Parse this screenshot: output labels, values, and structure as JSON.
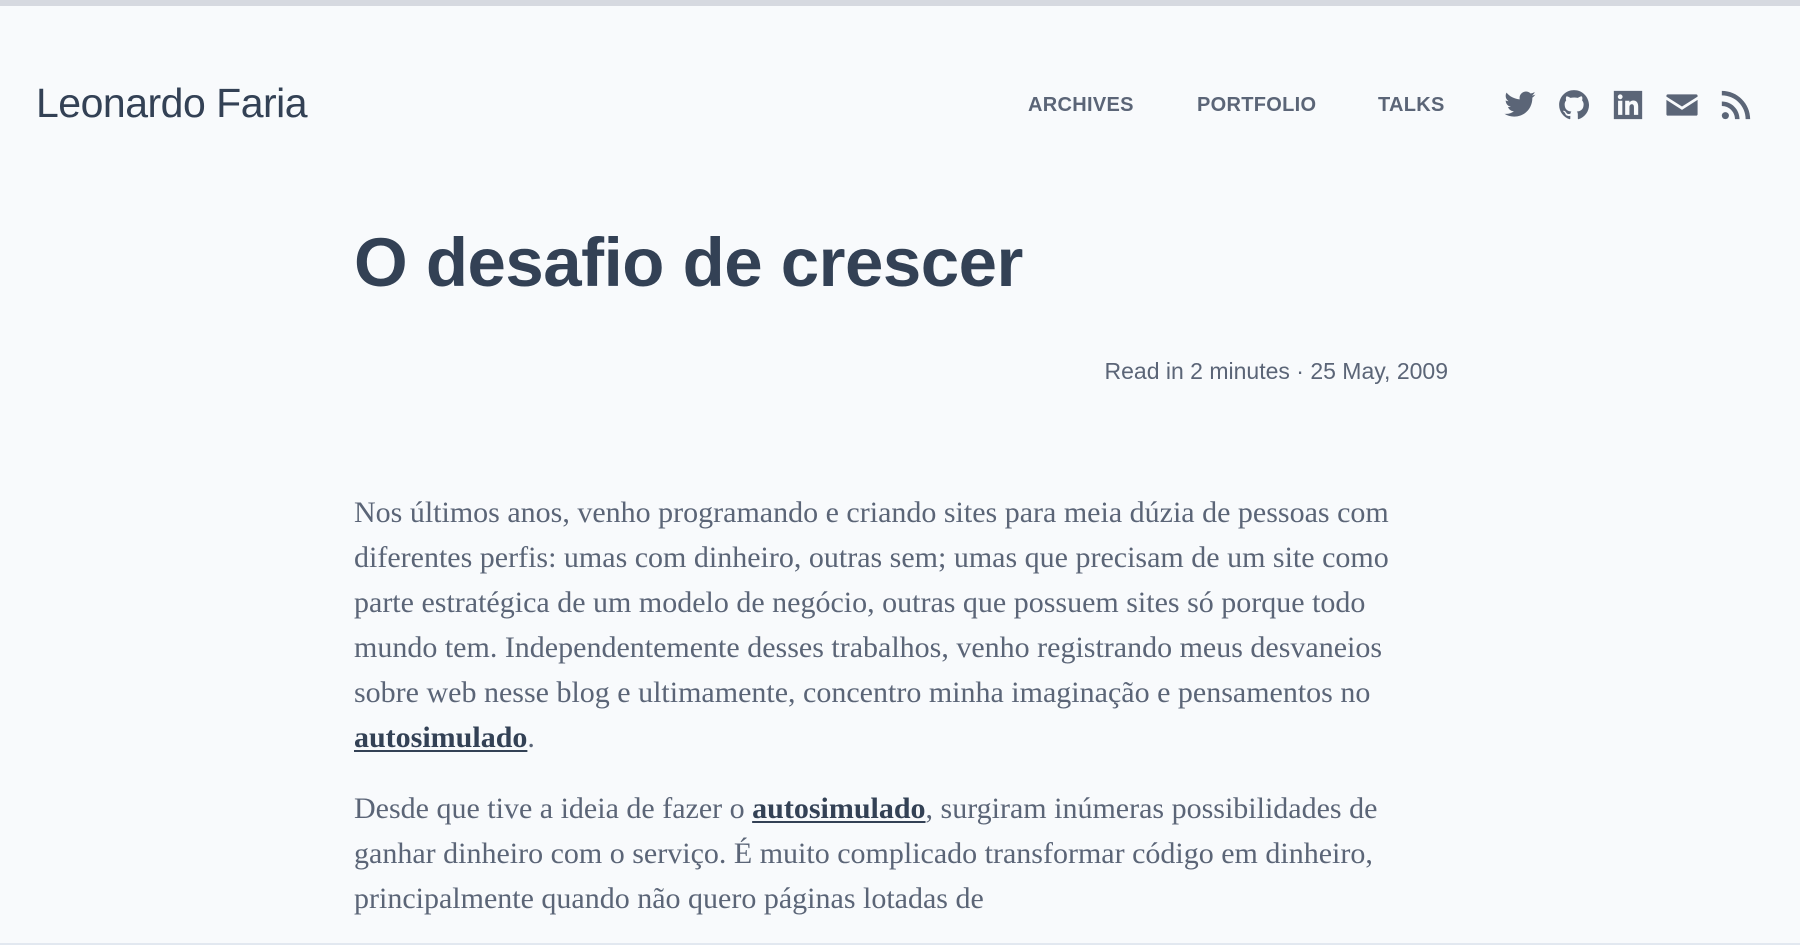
{
  "header": {
    "site_title": "Leonardo Faria",
    "nav": {
      "archives": "ARCHIVES",
      "portfolio": "PORTFOLIO",
      "talks": "TALKS"
    },
    "social_icons": [
      "twitter-icon",
      "github-icon",
      "linkedin-icon",
      "mail-icon",
      "rss-icon"
    ]
  },
  "post": {
    "title": "O desafio de crescer",
    "meta": "Read in 2 minutes · 25 May, 2009",
    "paragraph1": {
      "text": "Nos últimos anos, venho programando e criando sites para meia dúzia de pessoas com diferentes perfis: umas com dinheiro, outras sem; umas que precisam de um site como parte estratégica de um modelo de negócio, outras que possuem sites só porque todo mundo tem. Independentemente desses trabalhos, venho registrando meus desvaneios sobre web nesse blog e ultimamente, concentro minha imaginação e pensamentos no ",
      "link": "autosimulado",
      "tail": "."
    },
    "paragraph2": {
      "text": "Desde que tive a ideia de fazer o ",
      "link": "autosimulado",
      "tail": ", surgiram inúmeras possibilidades de ganhar dinheiro com o serviço. É muito complicado transformar código em dinheiro, principalmente quando não quero páginas lotadas de"
    }
  },
  "colors": {
    "background": "#f8fafc",
    "heading": "#334155",
    "body_text": "#5b6577",
    "top_bar": "#d6d9e0"
  }
}
